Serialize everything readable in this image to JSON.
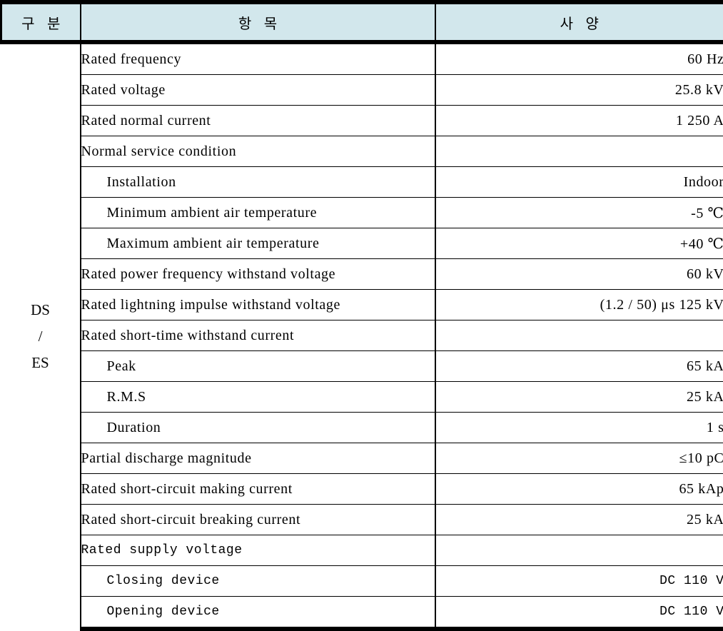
{
  "table": {
    "headers": {
      "division": "구 분",
      "item": "항 목",
      "spec": "사 양"
    },
    "division_label_lines": [
      "DS",
      "/",
      "ES"
    ],
    "rows": [
      {
        "item": "Rated frequency",
        "spec": "60 Hz",
        "sub": false,
        "font": "serif"
      },
      {
        "item": "Rated voltage",
        "spec": "25.8 kV",
        "sub": false,
        "font": "serif"
      },
      {
        "item": "Rated normal current",
        "spec": "1 250 A",
        "sub": false,
        "font": "serif"
      },
      {
        "item": "Normal service condition",
        "spec": "",
        "sub": false,
        "font": "serif"
      },
      {
        "item": "Installation",
        "spec": "Indoor",
        "sub": true,
        "font": "serif"
      },
      {
        "item": "Minimum ambient air temperature",
        "spec": "-5 ℃",
        "sub": true,
        "font": "serif"
      },
      {
        "item": "Maximum ambient air temperature",
        "spec": "+40 ℃",
        "sub": true,
        "font": "serif"
      },
      {
        "item": "Rated power frequency withstand voltage",
        "spec": "60 kV",
        "sub": false,
        "font": "serif"
      },
      {
        "item": "Rated lightning impulse withstand voltage",
        "spec": "(1.2 / 50) μs  125 kV",
        "sub": false,
        "font": "serif"
      },
      {
        "item": "Rated short-time withstand current",
        "spec": "",
        "sub": false,
        "font": "serif"
      },
      {
        "item": "Peak",
        "spec": "65 kA",
        "sub": true,
        "font": "serif"
      },
      {
        "item": "R.M.S",
        "spec": "25 kA",
        "sub": true,
        "font": "serif"
      },
      {
        "item": "Duration",
        "spec": "1 s",
        "sub": true,
        "font": "serif"
      },
      {
        "item": "Partial discharge magnitude",
        "spec": "≤10 pC",
        "sub": false,
        "font": "serif"
      },
      {
        "item": "Rated short-circuit making current",
        "spec": "65 kAp",
        "sub": false,
        "font": "serif"
      },
      {
        "item": "Rated short-circuit breaking current",
        "spec": "25 kA",
        "sub": false,
        "font": "serif"
      },
      {
        "item": "Rated supply voltage",
        "spec": "",
        "sub": false,
        "font": "gothic"
      },
      {
        "item": "Closing device",
        "spec": "DC 110 V",
        "sub": true,
        "font": "gothic"
      },
      {
        "item": "Opening device",
        "spec": "DC 110 V",
        "sub": true,
        "font": "gothic"
      }
    ]
  },
  "colors": {
    "header_background": "#d2e7ec",
    "border": "#000000",
    "text": "#000000"
  }
}
